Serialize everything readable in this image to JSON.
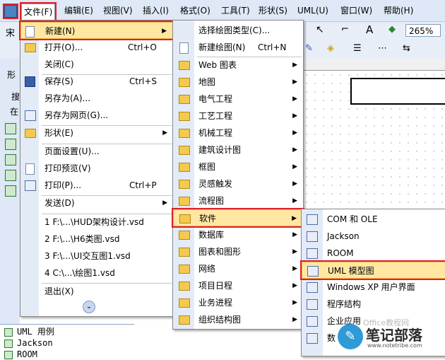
{
  "menubar": {
    "items": [
      "文件(F)",
      "编辑(E)",
      "视图(V)",
      "插入(I)",
      "格式(O)",
      "工具(T)",
      "形状(S)",
      "UML(U)",
      "窗口(W)",
      "帮助(H)"
    ]
  },
  "toolbar": {
    "zoom": "265%",
    "font_prefix": "宋",
    "a_glyph": "A"
  },
  "left_pane": {
    "tab_partial": "形",
    "search_partial": "搜",
    "in_partial": "在"
  },
  "stencil_list": {
    "items": [
      "UML 用例",
      "Jackson",
      "ROOM"
    ]
  },
  "file_menu": {
    "items": [
      {
        "label": "新建(N)",
        "shortcut": "",
        "arrow": true
      },
      {
        "label": "打开(O)...",
        "shortcut": "Ctrl+O",
        "arrow": false
      },
      {
        "label": "关闭(C)",
        "shortcut": "",
        "arrow": false
      },
      {
        "label": "保存(S)",
        "shortcut": "Ctrl+S",
        "arrow": false
      },
      {
        "label": "另存为(A)...",
        "shortcut": "",
        "arrow": false
      },
      {
        "label": "另存为网页(G)...",
        "shortcut": "",
        "arrow": false
      },
      {
        "label": "形状(E)",
        "shortcut": "",
        "arrow": true
      },
      {
        "label": "页面设置(U)...",
        "shortcut": "",
        "arrow": false
      },
      {
        "label": "打印预览(V)",
        "shortcut": "",
        "arrow": false
      },
      {
        "label": "打印(P)...",
        "shortcut": "Ctrl+P",
        "arrow": false
      },
      {
        "label": "发送(D)",
        "shortcut": "",
        "arrow": true
      },
      {
        "label": "1 F:\\...\\HUD架构设计.vsd",
        "shortcut": "",
        "arrow": false
      },
      {
        "label": "2 F:\\...\\H6类图.vsd",
        "shortcut": "",
        "arrow": false
      },
      {
        "label": "3 F:\\...\\UI交互图1.vsd",
        "shortcut": "",
        "arrow": false
      },
      {
        "label": "4 C:\\...\\绘图1.vsd",
        "shortcut": "",
        "arrow": false
      },
      {
        "label": "退出(X)",
        "shortcut": "",
        "arrow": false
      }
    ]
  },
  "new_menu": {
    "items": [
      {
        "label": "选择绘图类型(C)...",
        "shortcut": "",
        "arrow": false
      },
      {
        "label": "新建绘图(N)",
        "shortcut": "Ctrl+N",
        "arrow": false
      },
      {
        "label": "Web 图表",
        "arrow": true
      },
      {
        "label": "地图",
        "arrow": true
      },
      {
        "label": "电气工程",
        "arrow": true
      },
      {
        "label": "工艺工程",
        "arrow": true
      },
      {
        "label": "机械工程",
        "arrow": true
      },
      {
        "label": "建筑设计图",
        "arrow": true
      },
      {
        "label": "框图",
        "arrow": true
      },
      {
        "label": "灵感触发",
        "arrow": true
      },
      {
        "label": "流程图",
        "arrow": true
      },
      {
        "label": "软件",
        "arrow": true
      },
      {
        "label": "数据库",
        "arrow": true
      },
      {
        "label": "图表和图形",
        "arrow": true
      },
      {
        "label": "网络",
        "arrow": true
      },
      {
        "label": "项目日程",
        "arrow": true
      },
      {
        "label": "业务进程",
        "arrow": true
      },
      {
        "label": "组织结构图",
        "arrow": true
      }
    ]
  },
  "software_menu": {
    "items": [
      "COM 和 OLE",
      "Jackson",
      "ROOM",
      "UML 模型图",
      "Windows XP 用户界面",
      "程序结构",
      "企业应用"
    ],
    "last_partial": "数"
  },
  "watermark": {
    "text": "笔记部落",
    "url": "www.notetribe.com",
    "faded": "Office教程网"
  },
  "colors": {
    "highlight": "#ffe7a2",
    "highlight_border": "#e8b84a",
    "red_annotation": "#e0202a",
    "menubar_bg": "#dfe8f6"
  }
}
